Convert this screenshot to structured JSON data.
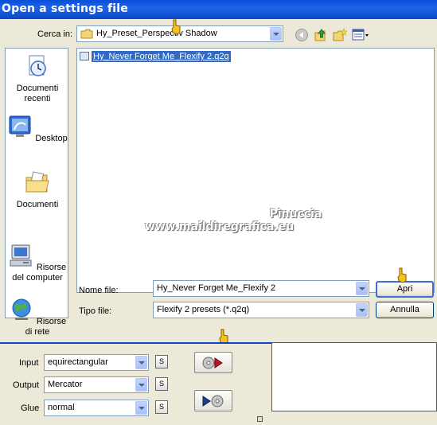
{
  "window": {
    "title": "Open a settings file"
  },
  "lookin": {
    "label": "Cerca in:",
    "value": "Hy_Preset_Perspectiv Shadow"
  },
  "places": [
    {
      "label": "Documenti recenti",
      "icon": "recent-documents-icon"
    },
    {
      "label": "Desktop",
      "icon": "desktop-icon"
    },
    {
      "label": "Documenti",
      "icon": "documents-folder-icon"
    },
    {
      "label": "Risorse del computer",
      "icon": "my-computer-icon"
    },
    {
      "label": "Risorse di rete",
      "icon": "network-icon"
    }
  ],
  "files": [
    {
      "name": "Hy_Never Forget Me_Flexify 2.q2q",
      "selected": true
    }
  ],
  "watermark": {
    "line1": "Pinuccia",
    "line2": "www.maildiregrafica.eu"
  },
  "filename": {
    "label": "Nome file:",
    "value": "Hy_Never Forget Me_Flexify 2"
  },
  "filetype": {
    "label": "Tipo file:",
    "value": "Flexify 2 presets (*.q2q)"
  },
  "buttons": {
    "open": "Apri",
    "cancel": "Annulla"
  },
  "flexify": {
    "input": {
      "label": "Input",
      "value": "equirectangular"
    },
    "output": {
      "label": "Output",
      "value": "Mercator"
    },
    "glue": {
      "label": "Glue",
      "value": "normal"
    },
    "s_label": "S"
  },
  "colors": {
    "title_bar": "#0a4fd8",
    "dialog_bg": "#ece9d8",
    "selection": "#316ac5",
    "border": "#7f9db9"
  }
}
